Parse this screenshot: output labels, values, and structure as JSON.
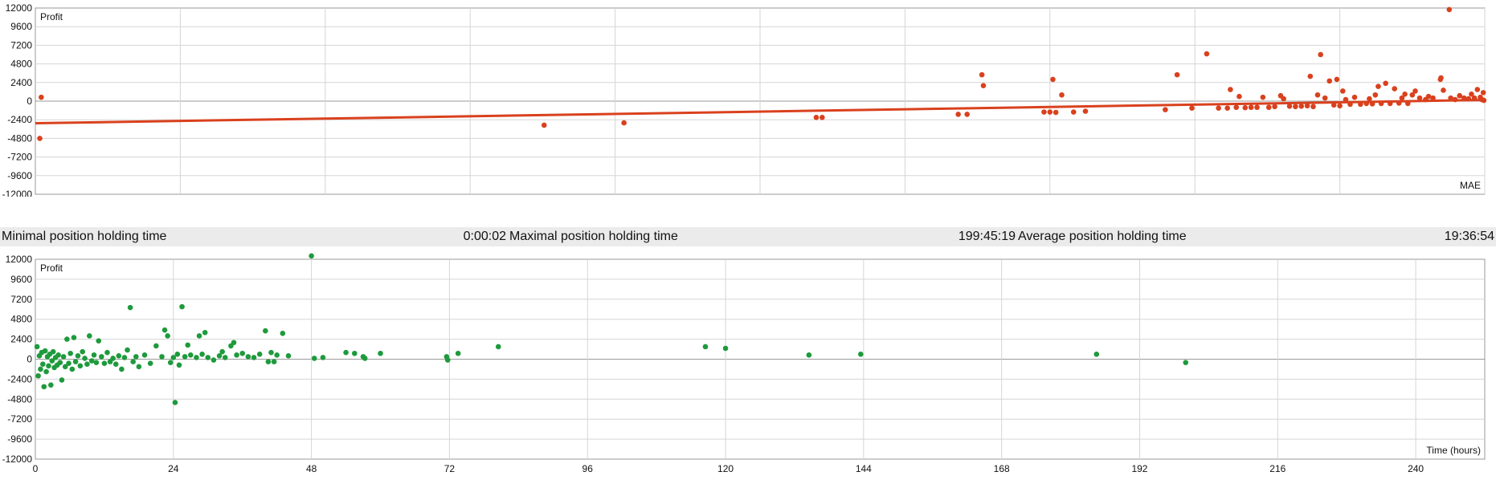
{
  "chart_data": [
    {
      "type": "scatter",
      "title": "",
      "ylabel": "Profit",
      "xlabel": "MAE",
      "xlim": [
        -4900,
        0
      ],
      "ylim": [
        -12000,
        12000
      ],
      "x_ticks": [
        "-4900",
        "-4410",
        "-3920",
        "-3430",
        "-2940",
        "-2450",
        "-1960",
        "-1470",
        "-980",
        "-490",
        "0"
      ],
      "y_ticks": [
        "12000",
        "9600",
        "7200",
        "4800",
        "2400",
        "0",
        "-2400",
        "-4800",
        "-7200",
        "-9600",
        "-12000"
      ],
      "grid": true,
      "colors": {
        "points": "#d9411e",
        "trend": "#d9411e",
        "grid": "#d5d5d5",
        "axis": "#999999"
      },
      "trendline": {
        "x": [
          -4900,
          0
        ],
        "y": [
          -2850,
          150
        ]
      },
      "points": [
        {
          "x": -4880,
          "y": 500
        },
        {
          "x": -4885,
          "y": -4800
        },
        {
          "x": -3180,
          "y": -3100
        },
        {
          "x": -2910,
          "y": -2800
        },
        {
          "x": -2260,
          "y": -2100
        },
        {
          "x": -2240,
          "y": -2100
        },
        {
          "x": -1780,
          "y": -1700
        },
        {
          "x": -1750,
          "y": -1700
        },
        {
          "x": -1700,
          "y": 3400
        },
        {
          "x": -1695,
          "y": 2000
        },
        {
          "x": -1490,
          "y": -1400
        },
        {
          "x": -1470,
          "y": -1400
        },
        {
          "x": -1460,
          "y": 2800
        },
        {
          "x": -1450,
          "y": -1450
        },
        {
          "x": -1430,
          "y": 800
        },
        {
          "x": -1390,
          "y": -1400
        },
        {
          "x": -1350,
          "y": -1300
        },
        {
          "x": -1080,
          "y": -1100
        },
        {
          "x": -1040,
          "y": 3400
        },
        {
          "x": -990,
          "y": -900
        },
        {
          "x": -940,
          "y": 6100
        },
        {
          "x": -900,
          "y": -900
        },
        {
          "x": -870,
          "y": -900
        },
        {
          "x": -860,
          "y": 1500
        },
        {
          "x": -840,
          "y": -800
        },
        {
          "x": -830,
          "y": 600
        },
        {
          "x": -810,
          "y": -850
        },
        {
          "x": -790,
          "y": -800
        },
        {
          "x": -770,
          "y": -800
        },
        {
          "x": -750,
          "y": 500
        },
        {
          "x": -730,
          "y": -800
        },
        {
          "x": -710,
          "y": -700
        },
        {
          "x": -690,
          "y": 700
        },
        {
          "x": -680,
          "y": 300
        },
        {
          "x": -660,
          "y": -650
        },
        {
          "x": -640,
          "y": -700
        },
        {
          "x": -620,
          "y": -650
        },
        {
          "x": -600,
          "y": -600
        },
        {
          "x": -590,
          "y": 3200
        },
        {
          "x": -580,
          "y": -700
        },
        {
          "x": -565,
          "y": 800
        },
        {
          "x": -555,
          "y": 6000
        },
        {
          "x": -540,
          "y": 400
        },
        {
          "x": -525,
          "y": 2600
        },
        {
          "x": -510,
          "y": -500
        },
        {
          "x": -500,
          "y": 2800
        },
        {
          "x": -490,
          "y": -600
        },
        {
          "x": -480,
          "y": 1300
        },
        {
          "x": -470,
          "y": 200
        },
        {
          "x": -455,
          "y": -400
        },
        {
          "x": -440,
          "y": 500
        },
        {
          "x": -420,
          "y": -400
        },
        {
          "x": -400,
          "y": -300
        },
        {
          "x": -390,
          "y": 300
        },
        {
          "x": -380,
          "y": -350
        },
        {
          "x": -370,
          "y": 800
        },
        {
          "x": -360,
          "y": 1900
        },
        {
          "x": -350,
          "y": -300
        },
        {
          "x": -335,
          "y": 2300
        },
        {
          "x": -320,
          "y": -300
        },
        {
          "x": -305,
          "y": 1600
        },
        {
          "x": -290,
          "y": -250
        },
        {
          "x": -280,
          "y": 400
        },
        {
          "x": -270,
          "y": 900
        },
        {
          "x": -260,
          "y": -300
        },
        {
          "x": -245,
          "y": 800
        },
        {
          "x": -235,
          "y": 1300
        },
        {
          "x": -220,
          "y": 400
        },
        {
          "x": -200,
          "y": 200
        },
        {
          "x": -190,
          "y": 600
        },
        {
          "x": -175,
          "y": 400
        },
        {
          "x": -150,
          "y": 2800
        },
        {
          "x": -148,
          "y": 3000
        },
        {
          "x": -140,
          "y": 1400
        },
        {
          "x": -120,
          "y": 11800
        },
        {
          "x": -115,
          "y": 400
        },
        {
          "x": -100,
          "y": 200
        },
        {
          "x": -85,
          "y": 700
        },
        {
          "x": -70,
          "y": 400
        },
        {
          "x": -55,
          "y": 300
        },
        {
          "x": -45,
          "y": 900
        },
        {
          "x": -35,
          "y": 400
        },
        {
          "x": -25,
          "y": 1500
        },
        {
          "x": -15,
          "y": 500
        },
        {
          "x": -10,
          "y": 200
        },
        {
          "x": -5,
          "y": 1100
        },
        {
          "x": -3,
          "y": 100
        }
      ]
    },
    {
      "type": "scatter",
      "title": "",
      "ylabel": "Profit",
      "xlabel": "Time (hours)",
      "xlim": [
        0,
        252
      ],
      "ylim": [
        -12000,
        12000
      ],
      "x_ticks": [
        "0",
        "24",
        "48",
        "72",
        "96",
        "120",
        "144",
        "168",
        "192",
        "216",
        "240"
      ],
      "y_ticks": [
        "12000",
        "9600",
        "7200",
        "4800",
        "2400",
        "0",
        "-2400",
        "-4800",
        "-7200",
        "-9600",
        "-12000"
      ],
      "grid": true,
      "colors": {
        "points": "#1e9a3c",
        "grid": "#d5d5d5",
        "axis": "#999999"
      },
      "points": [
        {
          "x": 0.3,
          "y": 1500
        },
        {
          "x": 0.5,
          "y": -2000
        },
        {
          "x": 0.7,
          "y": 400
        },
        {
          "x": 0.9,
          "y": -1200
        },
        {
          "x": 1.1,
          "y": 800
        },
        {
          "x": 1.3,
          "y": -600
        },
        {
          "x": 1.5,
          "y": -3300
        },
        {
          "x": 1.7,
          "y": 1000
        },
        {
          "x": 1.9,
          "y": -1500
        },
        {
          "x": 2.1,
          "y": 300
        },
        {
          "x": 2.3,
          "y": -800
        },
        {
          "x": 2.5,
          "y": 600
        },
        {
          "x": 2.7,
          "y": -3100
        },
        {
          "x": 2.9,
          "y": -200
        },
        {
          "x": 3.1,
          "y": 900
        },
        {
          "x": 3.3,
          "y": -1000
        },
        {
          "x": 3.5,
          "y": 200
        },
        {
          "x": 3.8,
          "y": -700
        },
        {
          "x": 4.0,
          "y": 500
        },
        {
          "x": 4.3,
          "y": -400
        },
        {
          "x": 4.6,
          "y": -2500
        },
        {
          "x": 4.9,
          "y": 300
        },
        {
          "x": 5.2,
          "y": -900
        },
        {
          "x": 5.5,
          "y": 2400
        },
        {
          "x": 5.8,
          "y": -500
        },
        {
          "x": 6.1,
          "y": 700
        },
        {
          "x": 6.4,
          "y": -1200
        },
        {
          "x": 6.7,
          "y": 2600
        },
        {
          "x": 7.0,
          "y": -300
        },
        {
          "x": 7.4,
          "y": 400
        },
        {
          "x": 7.8,
          "y": -800
        },
        {
          "x": 8.2,
          "y": 900
        },
        {
          "x": 8.6,
          "y": 100
        },
        {
          "x": 9.0,
          "y": -600
        },
        {
          "x": 9.4,
          "y": 2800
        },
        {
          "x": 9.8,
          "y": -200
        },
        {
          "x": 10.2,
          "y": 500
        },
        {
          "x": 10.6,
          "y": -400
        },
        {
          "x": 11.0,
          "y": 2200
        },
        {
          "x": 11.5,
          "y": 300
        },
        {
          "x": 12.0,
          "y": -500
        },
        {
          "x": 12.5,
          "y": 800
        },
        {
          "x": 13.0,
          "y": -300
        },
        {
          "x": 13.5,
          "y": 100
        },
        {
          "x": 14.0,
          "y": -600
        },
        {
          "x": 14.5,
          "y": 400
        },
        {
          "x": 15.0,
          "y": -1200
        },
        {
          "x": 15.5,
          "y": 200
        },
        {
          "x": 16.0,
          "y": 1100
        },
        {
          "x": 16.5,
          "y": 6200
        },
        {
          "x": 17.0,
          "y": -300
        },
        {
          "x": 17.5,
          "y": 300
        },
        {
          "x": 18.0,
          "y": -900
        },
        {
          "x": 19.0,
          "y": 500
        },
        {
          "x": 20.0,
          "y": -500
        },
        {
          "x": 21.0,
          "y": 1600
        },
        {
          "x": 22.0,
          "y": 300
        },
        {
          "x": 22.5,
          "y": 3500
        },
        {
          "x": 23.0,
          "y": 2800
        },
        {
          "x": 23.5,
          "y": -400
        },
        {
          "x": 24.0,
          "y": 200
        },
        {
          "x": 24.3,
          "y": -5200
        },
        {
          "x": 24.7,
          "y": 600
        },
        {
          "x": 25.0,
          "y": -700
        },
        {
          "x": 25.5,
          "y": 6300
        },
        {
          "x": 26.0,
          "y": 300
        },
        {
          "x": 26.5,
          "y": 1700
        },
        {
          "x": 27.0,
          "y": 500
        },
        {
          "x": 28.0,
          "y": 200
        },
        {
          "x": 28.5,
          "y": 2800
        },
        {
          "x": 29.0,
          "y": 600
        },
        {
          "x": 29.5,
          "y": 3200
        },
        {
          "x": 30.0,
          "y": 200
        },
        {
          "x": 31.0,
          "y": -100
        },
        {
          "x": 32.0,
          "y": 400
        },
        {
          "x": 32.5,
          "y": 900
        },
        {
          "x": 33.0,
          "y": 200
        },
        {
          "x": 34.0,
          "y": 1600
        },
        {
          "x": 34.5,
          "y": 2000
        },
        {
          "x": 35.0,
          "y": 500
        },
        {
          "x": 36.0,
          "y": 700
        },
        {
          "x": 37.0,
          "y": 300
        },
        {
          "x": 38.0,
          "y": 200
        },
        {
          "x": 39.0,
          "y": 600
        },
        {
          "x": 40.0,
          "y": 3400
        },
        {
          "x": 40.5,
          "y": -300
        },
        {
          "x": 41.0,
          "y": 800
        },
        {
          "x": 41.5,
          "y": -300
        },
        {
          "x": 42.0,
          "y": 500
        },
        {
          "x": 43.0,
          "y": 3100
        },
        {
          "x": 44.0,
          "y": 400
        },
        {
          "x": 48.0,
          "y": 12400
        },
        {
          "x": 48.5,
          "y": 100
        },
        {
          "x": 50.0,
          "y": 200
        },
        {
          "x": 54.0,
          "y": 800
        },
        {
          "x": 55.5,
          "y": 700
        },
        {
          "x": 57.0,
          "y": 300
        },
        {
          "x": 57.3,
          "y": 100
        },
        {
          "x": 60.0,
          "y": 700
        },
        {
          "x": 71.5,
          "y": 300
        },
        {
          "x": 71.7,
          "y": -100
        },
        {
          "x": 73.5,
          "y": 700
        },
        {
          "x": 80.5,
          "y": 1500
        },
        {
          "x": 116.5,
          "y": 1500
        },
        {
          "x": 120.0,
          "y": 1300
        },
        {
          "x": 134.5,
          "y": 500
        },
        {
          "x": 143.5,
          "y": 600
        },
        {
          "x": 184.5,
          "y": 600
        },
        {
          "x": 200.0,
          "y": -400
        }
      ]
    }
  ],
  "stats": {
    "min_label": "Minimal position holding time",
    "min_value": "0:00:02",
    "max_label": "Maximal position holding time",
    "max_value": "199:45:19",
    "avg_label": "Average position holding time",
    "avg_value": "19:36:54"
  }
}
